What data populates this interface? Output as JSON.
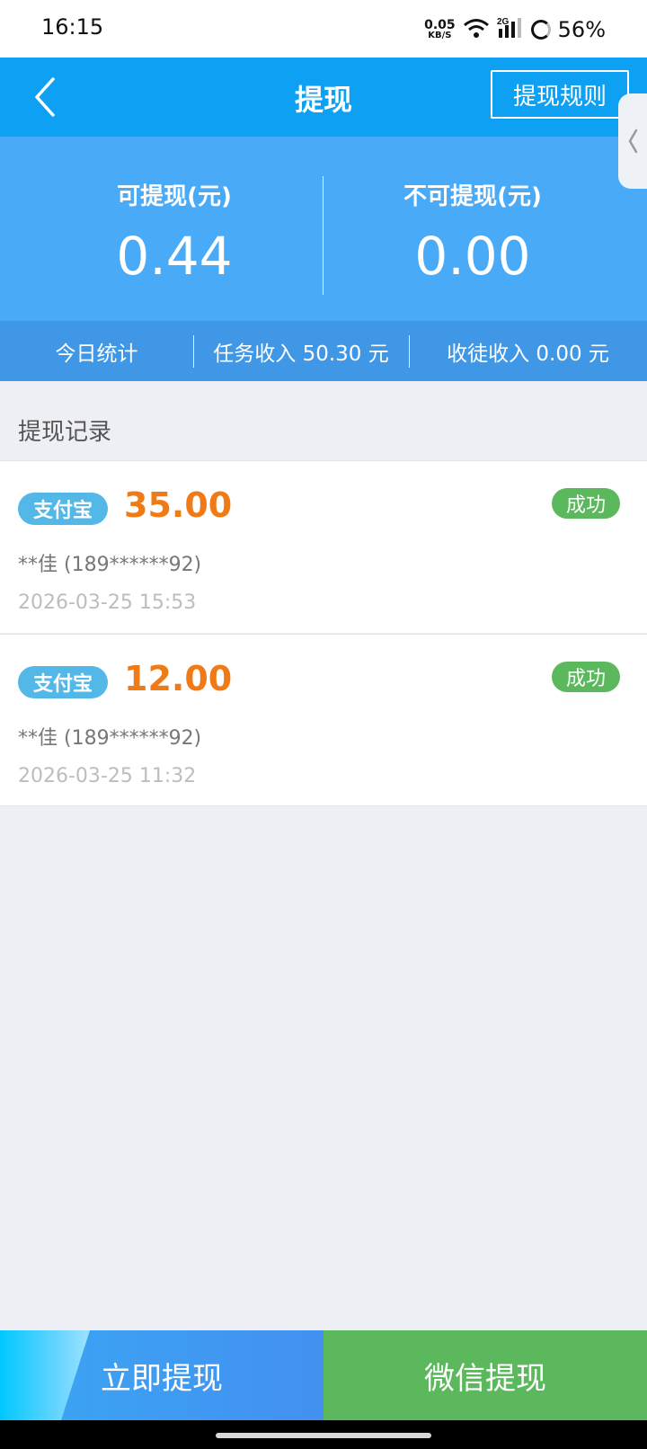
{
  "status_bar": {
    "time": "16:15",
    "net_speed": "0.05",
    "net_unit": "KB/S",
    "signal_type": "2G",
    "battery": "56%"
  },
  "header": {
    "title": "提现",
    "rules_label": "提现规则",
    "back_icon": "chevron-left-icon",
    "side_tab_icon": "chevron-left-icon"
  },
  "balance": {
    "available_label": "可提现(元)",
    "available_value": "0.44",
    "unavailable_label": "不可提现(元)",
    "unavailable_value": "0.00"
  },
  "stats": {
    "today_label": "今日统计",
    "task_income": "任务收入 50.30 元",
    "apprentice_income": "收徒收入 0.00 元"
  },
  "records": {
    "title": "提现记录",
    "items": [
      {
        "method": "支付宝",
        "amount": "35.00",
        "status": "成功",
        "account": "**佳 (189******92)",
        "time": "2026-03-25 15:53"
      },
      {
        "method": "支付宝",
        "amount": "12.00",
        "status": "成功",
        "account": "**佳 (189******92)",
        "time": "2026-03-25 11:32"
      }
    ]
  },
  "actions": {
    "withdraw_now": "立即提现",
    "wechat_withdraw": "微信提现"
  },
  "colors": {
    "header": "#0ea0f2",
    "balance_panel": "#49aaf7",
    "stats_bar": "#3f97e6",
    "amount": "#f07a16",
    "success": "#5cb85c",
    "alipay_badge": "#53b8e8"
  }
}
